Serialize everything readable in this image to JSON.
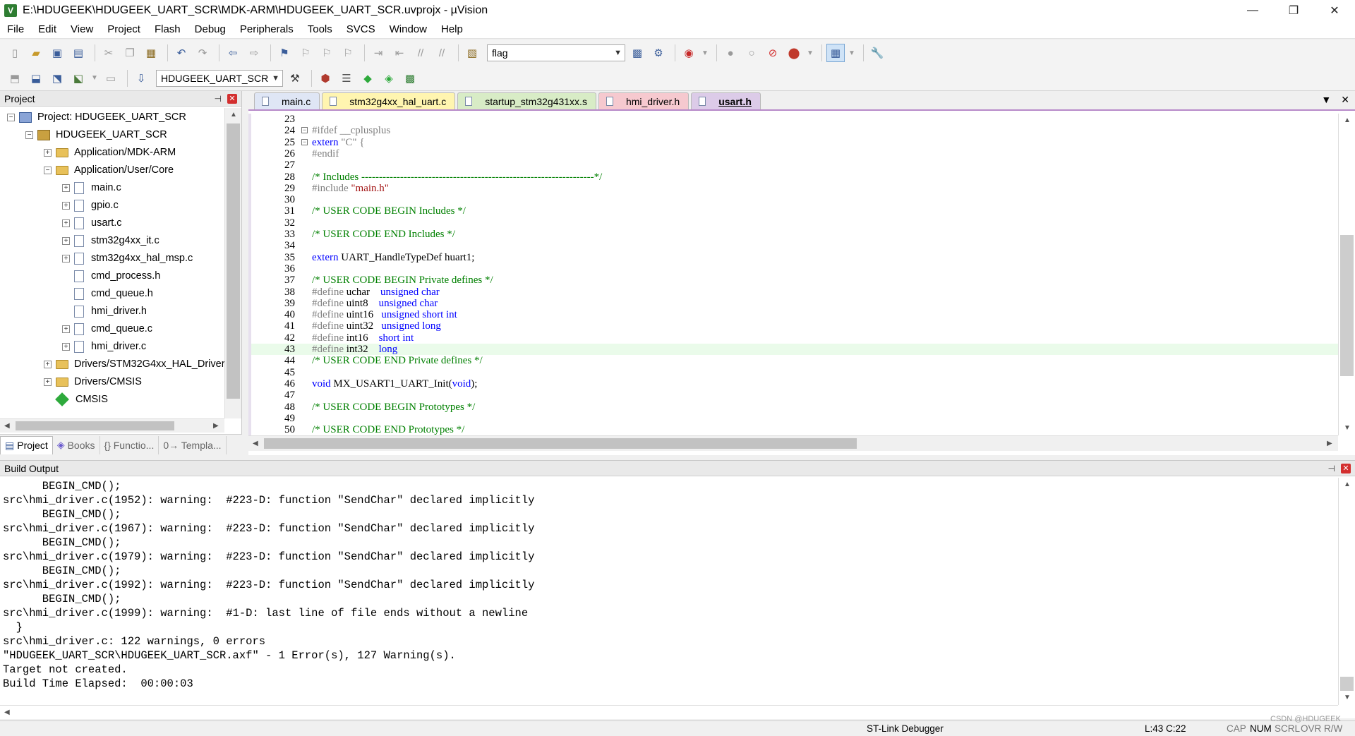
{
  "window": {
    "title": "E:\\HDUGEEK\\HDUGEEK_UART_SCR\\MDK-ARM\\HDUGEEK_UART_SCR.uvprojx - µVision",
    "minimize": "—",
    "restore": "❐",
    "close": "✕"
  },
  "menu": [
    "File",
    "Edit",
    "View",
    "Project",
    "Flash",
    "Debug",
    "Peripherals",
    "Tools",
    "SVCS",
    "Window",
    "Help"
  ],
  "toolbar": {
    "find_value": "flag",
    "target_value": "HDUGEEK_UART_SCR"
  },
  "project_panel": {
    "title": "Project",
    "tree": [
      {
        "label": "Project: HDUGEEK_UART_SCR",
        "level": 0,
        "expander": "−",
        "icon": "project"
      },
      {
        "label": "HDUGEEK_UART_SCR",
        "level": 1,
        "expander": "−",
        "icon": "target"
      },
      {
        "label": "Application/MDK-ARM",
        "level": 2,
        "expander": "+",
        "icon": "folder"
      },
      {
        "label": "Application/User/Core",
        "level": 2,
        "expander": "−",
        "icon": "folder"
      },
      {
        "label": "main.c",
        "level": 3,
        "expander": "+",
        "icon": "file"
      },
      {
        "label": "gpio.c",
        "level": 3,
        "expander": "+",
        "icon": "file"
      },
      {
        "label": "usart.c",
        "level": 3,
        "expander": "+",
        "icon": "file"
      },
      {
        "label": "stm32g4xx_it.c",
        "level": 3,
        "expander": "+",
        "icon": "file"
      },
      {
        "label": "stm32g4xx_hal_msp.c",
        "level": 3,
        "expander": "+",
        "icon": "file"
      },
      {
        "label": "cmd_process.h",
        "level": 3,
        "expander": "",
        "icon": "file"
      },
      {
        "label": "cmd_queue.h",
        "level": 3,
        "expander": "",
        "icon": "file"
      },
      {
        "label": "hmi_driver.h",
        "level": 3,
        "expander": "",
        "icon": "file"
      },
      {
        "label": "cmd_queue.c",
        "level": 3,
        "expander": "+",
        "icon": "file"
      },
      {
        "label": "hmi_driver.c",
        "level": 3,
        "expander": "+",
        "icon": "file"
      },
      {
        "label": "Drivers/STM32G4xx_HAL_Driver",
        "level": 2,
        "expander": "+",
        "icon": "folder"
      },
      {
        "label": "Drivers/CMSIS",
        "level": 2,
        "expander": "+",
        "icon": "folder"
      },
      {
        "label": "CMSIS",
        "level": 2,
        "expander": "",
        "icon": "diamond"
      }
    ],
    "tabs": [
      "Project",
      "Books",
      "{} Functio...",
      "0→ Templa..."
    ]
  },
  "editor": {
    "tabs": [
      "main.c",
      "stm32g4xx_hal_uart.c",
      "startup_stm32g431xx.s",
      "hmi_driver.h",
      "usart.h"
    ],
    "active_tab": "usart.h",
    "lines": [
      {
        "n": "23",
        "t": ""
      },
      {
        "n": "24",
        "t": "#ifdef __cplusplus",
        "fold": "−"
      },
      {
        "n": "25",
        "t": "extern \"C\" {",
        "fold": "−"
      },
      {
        "n": "26",
        "t": "#endif"
      },
      {
        "n": "27",
        "t": ""
      },
      {
        "n": "28",
        "t": "/* Includes ------------------------------------------------------------------*/"
      },
      {
        "n": "29",
        "t": "#include \"main.h\""
      },
      {
        "n": "30",
        "t": ""
      },
      {
        "n": "31",
        "t": "/* USER CODE BEGIN Includes */"
      },
      {
        "n": "32",
        "t": ""
      },
      {
        "n": "33",
        "t": "/* USER CODE END Includes */"
      },
      {
        "n": "34",
        "t": ""
      },
      {
        "n": "35",
        "t": "extern UART_HandleTypeDef huart1;"
      },
      {
        "n": "36",
        "t": ""
      },
      {
        "n": "37",
        "t": "/* USER CODE BEGIN Private defines */"
      },
      {
        "n": "38",
        "t": "#define uchar    unsigned char"
      },
      {
        "n": "39",
        "t": "#define uint8    unsigned char"
      },
      {
        "n": "40",
        "t": "#define uint16   unsigned short int"
      },
      {
        "n": "41",
        "t": "#define uint32   unsigned long"
      },
      {
        "n": "42",
        "t": "#define int16    short int"
      },
      {
        "n": "43",
        "t": "#define int32    long"
      },
      {
        "n": "44",
        "t": "/* USER CODE END Private defines */"
      },
      {
        "n": "45",
        "t": ""
      },
      {
        "n": "46",
        "t": "void MX_USART1_UART_Init(void);"
      },
      {
        "n": "47",
        "t": ""
      },
      {
        "n": "48",
        "t": "/* USER CODE BEGIN Prototypes */"
      },
      {
        "n": "49",
        "t": ""
      },
      {
        "n": "50",
        "t": "/* USER CODE END Prototypes */"
      }
    ]
  },
  "build_output": {
    "title": "Build Output",
    "lines": [
      "      BEGIN_CMD();",
      "src\\hmi_driver.c(1952): warning:  #223-D: function \"SendChar\" declared implicitly",
      "      BEGIN_CMD();",
      "src\\hmi_driver.c(1967): warning:  #223-D: function \"SendChar\" declared implicitly",
      "      BEGIN_CMD();",
      "src\\hmi_driver.c(1979): warning:  #223-D: function \"SendChar\" declared implicitly",
      "      BEGIN_CMD();",
      "src\\hmi_driver.c(1992): warning:  #223-D: function \"SendChar\" declared implicitly",
      "      BEGIN_CMD();",
      "src\\hmi_driver.c(1999): warning:  #1-D: last line of file ends without a newline",
      "  }",
      "src\\hmi_driver.c: 122 warnings, 0 errors",
      "\"HDUGEEK_UART_SCR\\HDUGEEK_UART_SCR.axf\" - 1 Error(s), 127 Warning(s).",
      "Target not created.",
      "Build Time Elapsed:  00:00:03"
    ]
  },
  "status": {
    "debugger": "ST-Link Debugger",
    "position": "L:43 C:22",
    "caps": "CAP",
    "num": "NUM",
    "scrl": "SCRL",
    "ovr": "OVR",
    "rw": "R/W",
    "watermark": "CSDN @HDUGEEK"
  }
}
